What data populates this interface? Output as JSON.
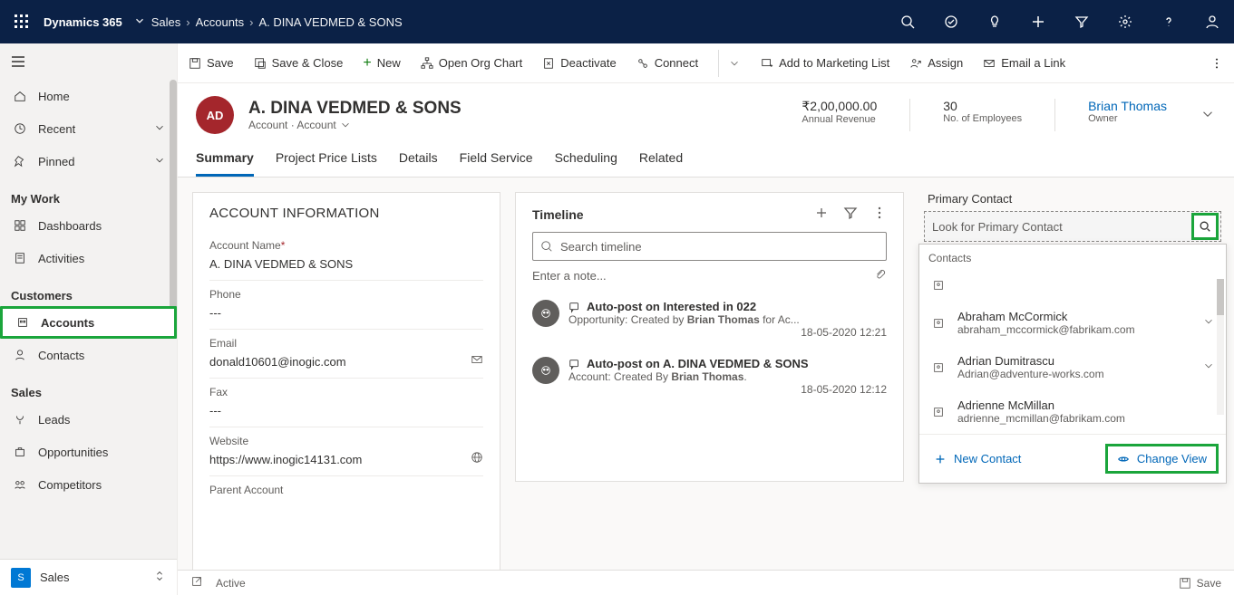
{
  "brand": "Dynamics 365",
  "breadcrumb": {
    "area": "Sales",
    "entity": "Accounts",
    "record": "A. DINA VEDMED & SONS"
  },
  "nav": {
    "home": "Home",
    "recent": "Recent",
    "pinned": "Pinned",
    "mywork_section": "My Work",
    "dashboards": "Dashboards",
    "activities": "Activities",
    "customers_section": "Customers",
    "accounts": "Accounts",
    "contacts": "Contacts",
    "sales_section": "Sales",
    "leads": "Leads",
    "opportunities": "Opportunities",
    "competitors": "Competitors",
    "area_badge": "S",
    "area_label": "Sales"
  },
  "cmd": {
    "save": "Save",
    "save_close": "Save & Close",
    "new": "New",
    "open_org": "Open Org Chart",
    "deactivate": "Deactivate",
    "connect": "Connect",
    "marketing": "Add to Marketing List",
    "assign": "Assign",
    "email_link": "Email a Link"
  },
  "header": {
    "initials": "AD",
    "title": "A. DINA VEDMED & SONS",
    "entity": "Account",
    "form": "Account",
    "revenue_val": "₹2,00,000.00",
    "revenue_lbl": "Annual Revenue",
    "emp_val": "30",
    "emp_lbl": "No. of Employees",
    "owner_val": "Brian Thomas",
    "owner_lbl": "Owner"
  },
  "tabs": {
    "summary": "Summary",
    "pricelists": "Project Price Lists",
    "details": "Details",
    "fieldservice": "Field Service",
    "scheduling": "Scheduling",
    "related": "Related"
  },
  "account": {
    "section": "ACCOUNT INFORMATION",
    "name_label": "Account Name",
    "name_val": "A. DINA VEDMED & SONS",
    "phone_label": "Phone",
    "phone_val": "---",
    "email_label": "Email",
    "email_val": "donald10601@inogic.com",
    "fax_label": "Fax",
    "fax_val": "---",
    "website_label": "Website",
    "website_val": "https://www.inogic14131.com",
    "parent_label": "Parent Account"
  },
  "timeline": {
    "title": "Timeline",
    "search_placeholder": "Search timeline",
    "note_placeholder": "Enter a note...",
    "item1_title": "Auto-post on Interested in 022",
    "item1_sub_prefix": "Opportunity: Created by ",
    "item1_sub_name": "Brian Thomas",
    "item1_sub_suffix": " for Ac...",
    "item1_date": "18-05-2020 12:21",
    "item2_title": "Auto-post on A. DINA VEDMED & SONS",
    "item2_sub_prefix": "Account: Created By ",
    "item2_sub_name": "Brian Thomas",
    "item2_sub_suffix": ".",
    "item2_date": "18-05-2020 12:12"
  },
  "primary_contact": {
    "label": "Primary Contact",
    "placeholder": "Look for Primary Contact",
    "header": "Contacts",
    "c1_name": "Abraham McCormick",
    "c1_email": "abraham_mccormick@fabrikam.com",
    "c2_name": "Adrian Dumitrascu",
    "c2_email": "Adrian@adventure-works.com",
    "c3_name": "Adrienne McMillan",
    "c3_email": "adrienne_mcmillan@fabrikam.com",
    "new_contact": "New Contact",
    "change_view": "Change View"
  },
  "statusbar": {
    "status": "Active",
    "save": "Save"
  }
}
